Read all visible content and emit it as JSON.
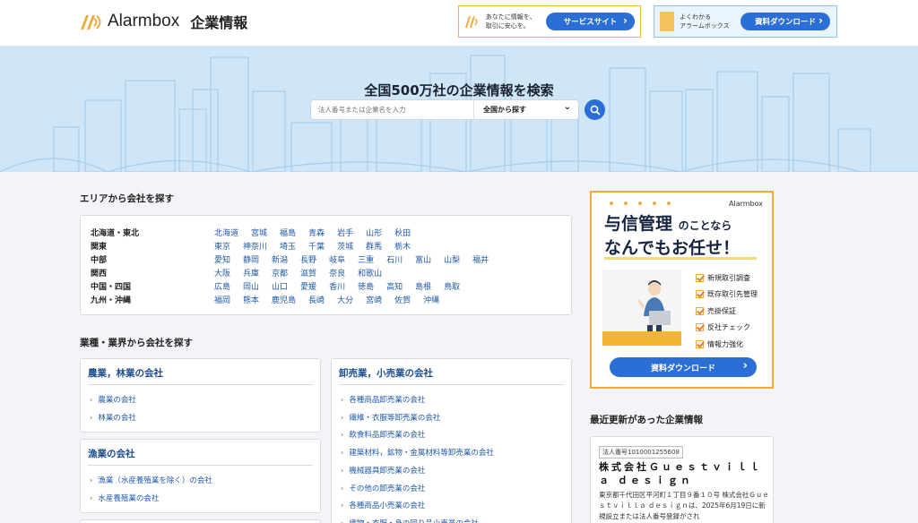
{
  "header": {
    "logo_text": "Alarmbox",
    "logo_sub": "企業情報",
    "promo1": {
      "text_line1": "あなたに情報を、",
      "text_line2": "取引に安心を。",
      "button": "サービスサイト"
    },
    "promo2": {
      "text_line1": "よくわかる",
      "text_line2": "アラームボックス",
      "button": "資料ダウンロード"
    }
  },
  "hero": {
    "title": "全国500万社の企業情報を検索",
    "search_placeholder": "法人番号または企業名を入力",
    "select_value": "全国から探す"
  },
  "area": {
    "title": "エリアから会社を探す",
    "rows": [
      {
        "region": "北海道・東北",
        "prefs": [
          "北海道",
          "宮城",
          "福島",
          "青森",
          "岩手",
          "山形",
          "秋田"
        ]
      },
      {
        "region": "関東",
        "prefs": [
          "東京",
          "神奈川",
          "埼玉",
          "千葉",
          "茨城",
          "群馬",
          "栃木"
        ]
      },
      {
        "region": "中部",
        "prefs": [
          "愛知",
          "静岡",
          "新潟",
          "長野",
          "岐阜",
          "三重",
          "石川",
          "富山",
          "山梨",
          "福井"
        ]
      },
      {
        "region": "関西",
        "prefs": [
          "大阪",
          "兵庫",
          "京都",
          "滋賀",
          "奈良",
          "和歌山"
        ]
      },
      {
        "region": "中国・四国",
        "prefs": [
          "広島",
          "岡山",
          "山口",
          "愛媛",
          "香川",
          "徳島",
          "高知",
          "島根",
          "鳥取"
        ]
      },
      {
        "region": "九州・沖縄",
        "prefs": [
          "福岡",
          "熊本",
          "鹿児島",
          "長崎",
          "大分",
          "宮崎",
          "佐賀",
          "沖縄"
        ]
      }
    ]
  },
  "industry": {
    "title": "業種・業界から会社を探す",
    "agri": {
      "title": "農業，林業の会社",
      "links": [
        "農業の会社",
        "林業の会社"
      ]
    },
    "fish": {
      "title": "漁業の会社",
      "links": [
        "漁業（水産養殖業を除く）の会社",
        "水産養殖業の会社"
      ]
    },
    "trade": {
      "title": "卸売業，小売業の会社",
      "links": [
        "各種商品卸売業の会社",
        "繊維・衣服等卸売業の会社",
        "飲食料品卸売業の会社",
        "建築材料，鉱物・金属材料等卸売業の会社",
        "機械器具卸売業の会社",
        "その他の卸売業の会社",
        "各種商品小売業の会社",
        "織物・衣服・身の回り品小売業の会社"
      ]
    }
  },
  "ad": {
    "brand": "Alarmbox",
    "headline_main": "与信管理",
    "headline_small": "のことなら",
    "headline2": "なんでもお任せ！",
    "features": [
      "新規取引調査",
      "既存取引先管理",
      "売掛保証",
      "反社チェック",
      "情報力強化"
    ],
    "button": "資料ダウンロード"
  },
  "recent": {
    "title": "最近更新があった企業情報",
    "badge": "法人番号1010001255608",
    "name": "株式会社Ｇｕｅｓｔｖｉｌｌａ ｄｅｓｉｇｎ",
    "desc": "東京都千代田区平河町１丁目９番１０号 株式会社Ｇｕｅｓｔｖｉｌｌａ ｄｅｓｉｇｎは、2025年6月19日に新規設立または法人番号登録がされ"
  },
  "colors": {
    "accent": "#2b6fd6",
    "orange": "#f2a93b",
    "link": "#2059a8",
    "hero_bg": "#cfe6f8"
  }
}
